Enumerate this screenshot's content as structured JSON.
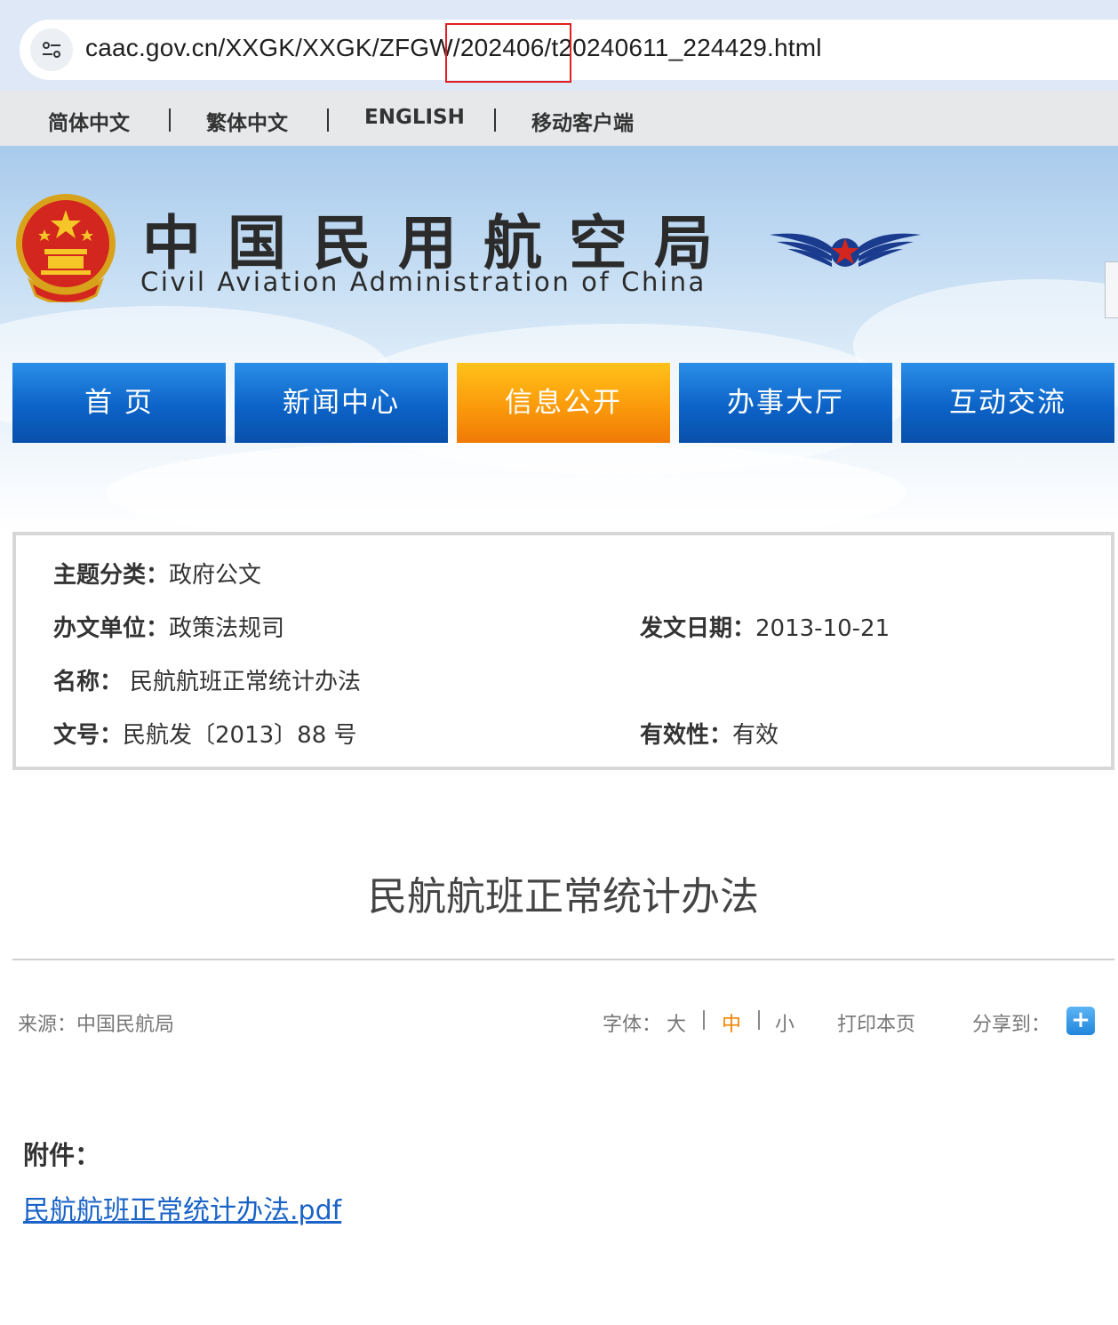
{
  "browser": {
    "url": "caac.gov.cn/XXGK/XXGK/ZFGW/202406/t20240611_224429.html",
    "highlight_color": "#e02020"
  },
  "lang_bar": {
    "items": [
      "简体中文",
      "繁体中文",
      "ENGLISH",
      "移动客户端"
    ]
  },
  "header": {
    "title_cn": "中国民用航空局",
    "title_en": "Civil Aviation Administration of China"
  },
  "nav": {
    "items": [
      {
        "label": "首 页",
        "active": false
      },
      {
        "label": "新闻中心",
        "active": false
      },
      {
        "label": "信息公开",
        "active": true
      },
      {
        "label": "办事大厅",
        "active": false
      },
      {
        "label": "互动交流",
        "active": false
      }
    ],
    "colors": {
      "normal": "#0c63c7",
      "active": "#fb9a0b"
    }
  },
  "meta": {
    "topic_key": "主题分类：",
    "topic_val": "政府公文",
    "dept_key": "办文单位：",
    "dept_val": "政策法规司",
    "date_key": "发文日期：",
    "date_val": "2013-10-21",
    "name_key": "名称：",
    "name_val": "民航航班正常统计办法",
    "docno_key": "文号：",
    "docno_val": "民航发〔2013〕88 号",
    "validity_key": "有效性：",
    "validity_val": "有效"
  },
  "article": {
    "title": "民航航班正常统计办法",
    "source_label": "来源：",
    "source_val": "中国民航局",
    "font_label": "字体：",
    "font_sizes": [
      "大",
      "中",
      "小"
    ],
    "font_current": "中",
    "print_label": "打印本页",
    "share_label": "分享到：",
    "share_icon": "+",
    "attachment_label": "附件：",
    "attachment_link": "民航航班正常统计办法.pdf",
    "link_color": "#1a63c7",
    "accent_color": "#f08300"
  }
}
